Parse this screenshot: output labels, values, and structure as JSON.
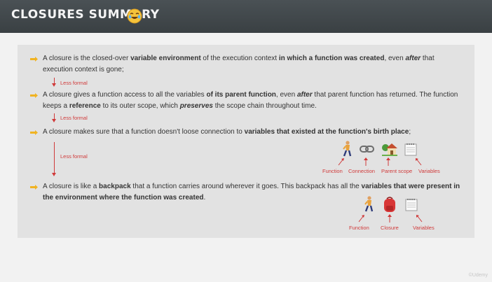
{
  "header": {
    "title": "CLOSURES SUMMARY",
    "emoji": "face-with-tears-of-joy-icon"
  },
  "bullets": [
    {
      "parts": [
        {
          "t": "A closure is the closed-over ",
          "b": false
        },
        {
          "t": "variable environment",
          "b": true
        },
        {
          "t": " of the execution context ",
          "b": false
        },
        {
          "t": "in which a function was created",
          "b": true
        },
        {
          "t": ", even ",
          "b": false
        },
        {
          "t": "after",
          "b": true,
          "i": true
        },
        {
          "t": " that execution context is gone;",
          "b": false
        }
      ]
    },
    {
      "parts": [
        {
          "t": "A closure gives a function access to all the variables ",
          "b": false
        },
        {
          "t": "of its parent function",
          "b": true
        },
        {
          "t": ", even ",
          "b": false
        },
        {
          "t": "after",
          "b": true,
          "i": true
        },
        {
          "t": " that parent function has returned. The function keeps a ",
          "b": false
        },
        {
          "t": "reference",
          "b": true
        },
        {
          "t": " to its outer scope, which ",
          "b": false
        },
        {
          "t": "preserves",
          "b": true,
          "i": true
        },
        {
          "t": " the scope chain throughout time.",
          "b": false
        }
      ]
    },
    {
      "parts": [
        {
          "t": "A closure makes sure that a function doesn't loose connection to ",
          "b": false
        },
        {
          "t": "variables that existed at the function's birth place",
          "b": true
        },
        {
          "t": ";",
          "b": false
        }
      ]
    },
    {
      "parts": [
        {
          "t": "A closure is like a ",
          "b": false
        },
        {
          "t": "backpack",
          "b": true
        },
        {
          "t": " that a function carries around wherever it goes. This backpack has all the ",
          "b": false
        },
        {
          "t": "variables that were present in the environment where the function was created",
          "b": true
        },
        {
          "t": ".",
          "b": false
        }
      ]
    }
  ],
  "less_formal": "Less formal",
  "diagram1": {
    "icons": [
      "walking-person-icon",
      "link-chain-icon",
      "house-with-garden-icon",
      "spiral-notepad-icon"
    ],
    "captions": [
      "Function",
      "Connection",
      "Parent scope",
      "Variables"
    ]
  },
  "diagram2": {
    "icons": [
      "walking-person-icon",
      "backpack-icon",
      "spiral-notepad-icon"
    ],
    "captions": [
      "Function",
      "Closure",
      "Variables"
    ]
  },
  "watermark": "©Udemy",
  "colors": {
    "header_bg": "#3f4548",
    "panel_bg": "#e2e2e2",
    "accent_red": "#d03a3a",
    "bullet_hand": "#f0b322"
  }
}
